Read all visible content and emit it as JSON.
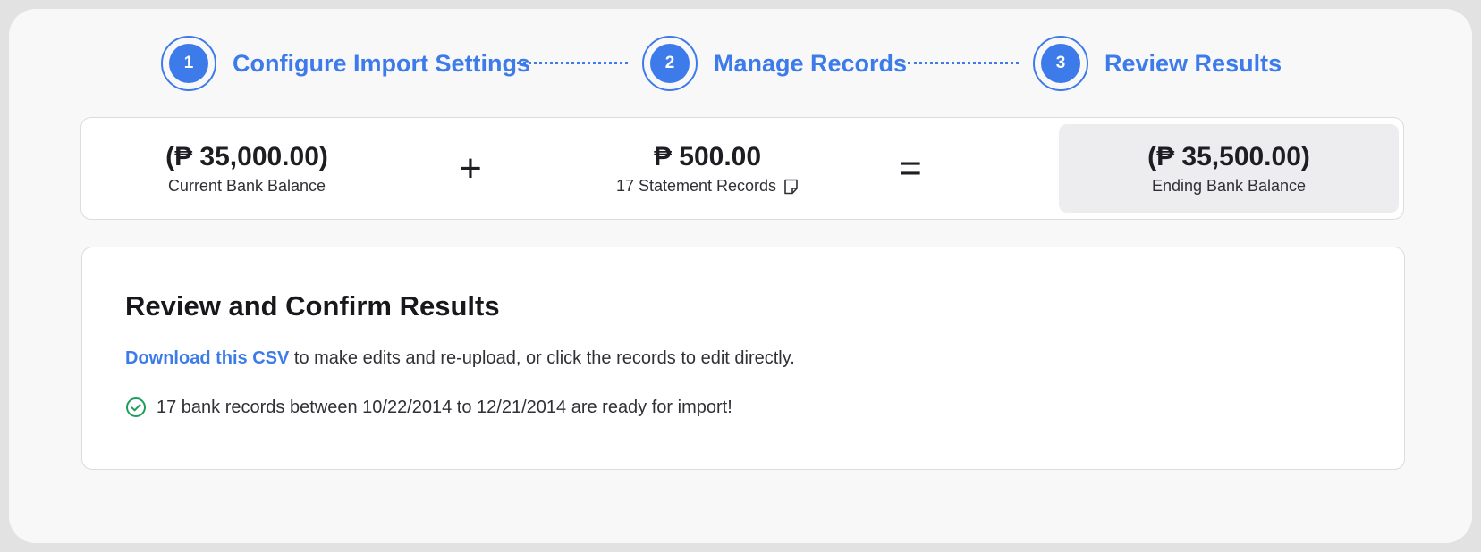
{
  "stepper": {
    "steps": [
      {
        "number": "1",
        "label": "Configure Import Settings"
      },
      {
        "number": "2",
        "label": "Manage Records"
      },
      {
        "number": "3",
        "label": "Review Results"
      }
    ]
  },
  "balance": {
    "current": {
      "amount": "(₱ 35,000.00)",
      "label": "Current Bank Balance"
    },
    "plus_symbol": "+",
    "statement": {
      "amount": "₱ 500.00",
      "label": "17 Statement Records",
      "icon": "note-icon"
    },
    "equals_symbol": "=",
    "ending": {
      "amount": "(₱ 35,500.00)",
      "label": "Ending Bank Balance"
    }
  },
  "review": {
    "title": "Review and Confirm Results",
    "download_link": "Download this CSV",
    "description_rest": " to make edits and re-upload, or click the records to edit directly.",
    "status_icon": "check-circle-icon",
    "status_text": "17 bank records between 10/22/2014 to 12/21/2014 are ready for import!"
  },
  "colors": {
    "accent": "#3d7bea",
    "success": "#1f9d5c",
    "ending_bg": "#ededf0"
  }
}
